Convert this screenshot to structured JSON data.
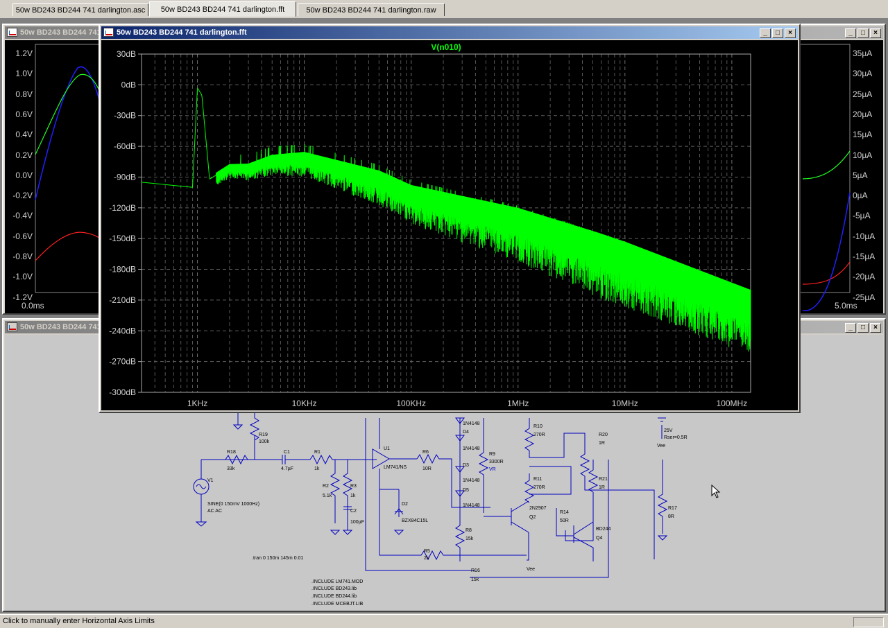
{
  "tabs": [
    {
      "label": "50w BD243 BD244 741 darlington.asc"
    },
    {
      "label": "50w BD243 BD244 741 darlington.fft"
    },
    {
      "label": "50w BD243 BD244 741 darlington.raw"
    }
  ],
  "windows": {
    "raw_title": "50w BD243 BD244 741 darlington.raw",
    "fft_title": "50w BD243 BD244 741 darlington.fft",
    "asc_title": "50w BD243 BD244 741 darlington.asc"
  },
  "raw_plot": {
    "left_ticks": [
      "1.2V",
      "1.0V",
      "0.8V",
      "0.6V",
      "0.4V",
      "0.2V",
      "0.0V",
      "-0.2V",
      "-0.4V",
      "-0.6V",
      "-0.8V",
      "-1.0V",
      "-1.2V"
    ],
    "right_ticks": [
      "35µA",
      "30µA",
      "25µA",
      "20µA",
      "15µA",
      "10µA",
      "5µA",
      "0µA",
      "-5µA",
      "-10µA",
      "-15µA",
      "-20µA",
      "-25µA"
    ],
    "x_start": "0.0ms",
    "x_end": "5.0ms"
  },
  "fft_plot": {
    "trace_label": "V(n010)",
    "y_ticks": [
      "30dB",
      "0dB",
      "-30dB",
      "-60dB",
      "-90dB",
      "-120dB",
      "-150dB",
      "-180dB",
      "-210dB",
      "-240dB",
      "-270dB",
      "-300dB"
    ],
    "x_ticks": [
      "1KHz",
      "10KHz",
      "100KHz",
      "1MHz",
      "10MHz",
      "100MHz"
    ],
    "trace_color": "#00ff00"
  },
  "chart_data": {
    "type": "line",
    "title": "V(n010)",
    "x_scale": "log",
    "xlim": [
      300,
      150000000
    ],
    "ylim": [
      -300,
      30
    ],
    "series": [
      {
        "name": "V(n010)",
        "x": [
          300,
          900,
          1000,
          1100,
          1300,
          2000,
          3000,
          5000,
          10000,
          50000,
          100000,
          1000000,
          10000000,
          100000000,
          150000000
        ],
        "y": [
          -95,
          -100,
          -3,
          -10,
          -92,
          -80,
          -80,
          -72,
          -70,
          -90,
          -105,
          -130,
          -165,
          -205,
          -212
        ]
      }
    ]
  },
  "schematic": {
    "labels": [
      "R19",
      "100k",
      "R18",
      "33k",
      "C1",
      "4.7µF",
      "R1",
      "1k",
      "U1",
      "LM741/NS",
      "R6",
      "10R",
      "1N4148",
      "D4",
      "1N4148",
      "D3",
      "1N4148",
      "D5",
      "1N4148",
      "R9",
      "3300R",
      "VR",
      "R10",
      "270R",
      "R20",
      "1R",
      "25V",
      "Rser=0.5R",
      "Vee",
      "R21",
      "1R",
      "R11",
      "270R",
      "2N2907",
      "Q2",
      "R14",
      "50R",
      "BD244",
      "Q4",
      "R17",
      "8R",
      "V1",
      "SINE(0 150mV 1000Hz)",
      "AC AC",
      "R2",
      "5.1k",
      "R3",
      "1k",
      "C2",
      "100µF",
      "D2",
      "BZX84C15L",
      "R8",
      "15k",
      "R5",
      "2k",
      "R16",
      "15k",
      ".tran 0 150m 145m 0.01",
      ".INCLUDE LM741.MOD",
      ".INCLUDE BD243.lib",
      ".INCLUDE BD244.lib",
      ".INCLUDE MCEBJT.LIB",
      "Vee"
    ]
  },
  "status": {
    "text": "Click to manually enter Horizontal Axis Limits"
  }
}
